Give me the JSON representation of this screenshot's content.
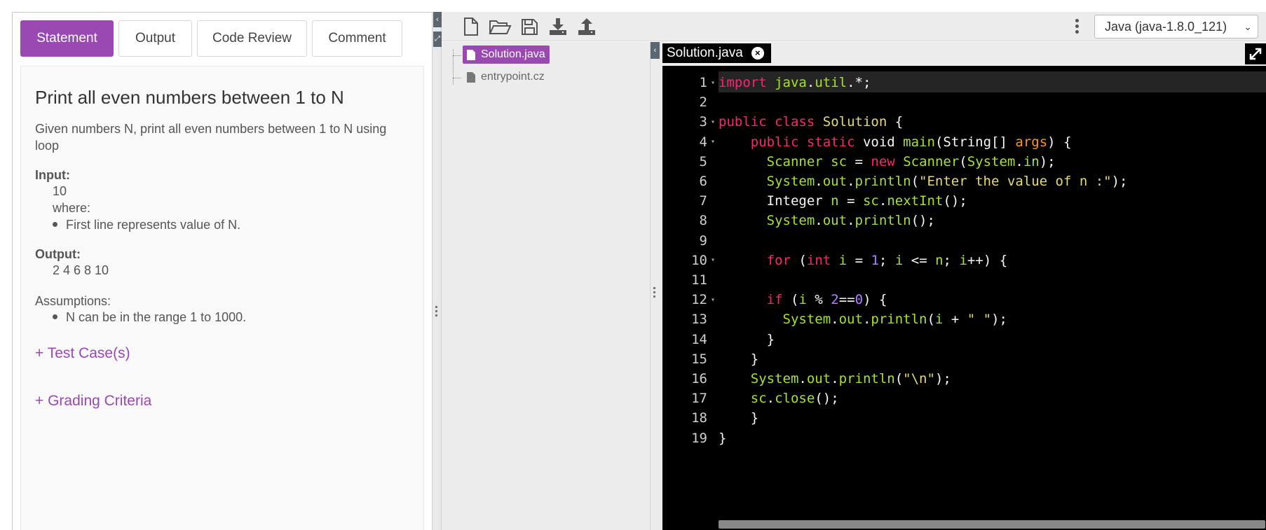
{
  "tabs": [
    {
      "label": "Statement"
    },
    {
      "label": "Output"
    },
    {
      "label": "Code Review"
    },
    {
      "label": "Comment"
    }
  ],
  "statement": {
    "title": "Print all even numbers between 1 to N",
    "description": "Given numbers N, print all even numbers between 1 to N using loop",
    "input_heading": "Input:",
    "input_value": "10",
    "input_where": "where:",
    "input_bullet": "First line represents value of N.",
    "output_heading": "Output:",
    "output_value": "2 4 6 8 10",
    "assumptions_heading": "Assumptions:",
    "assumptions_bullet": "N can be in the range 1 to 1000.",
    "test_cases_link": "+ Test Case(s)",
    "grading_link": "+ Grading Criteria"
  },
  "toolbar": {
    "icons": [
      "new-file-icon",
      "open-folder-icon",
      "save-icon",
      "download-icon",
      "upload-icon"
    ],
    "language": "Java (java-1.8.0_121)"
  },
  "file_tree": {
    "files": [
      {
        "name": "Solution.java",
        "active": true
      },
      {
        "name": "entrypoint.cz",
        "active": false
      }
    ]
  },
  "editor": {
    "tab_label": "Solution.java",
    "lines": [
      {
        "n": "1",
        "fold": true,
        "code": "import java.util.*;"
      },
      {
        "n": "2",
        "fold": false,
        "code": ""
      },
      {
        "n": "3",
        "fold": true,
        "code": "public class Solution {"
      },
      {
        "n": "4",
        "fold": true,
        "code": "    public static void main(String[] args) {"
      },
      {
        "n": "5",
        "fold": false,
        "code": "      Scanner sc = new Scanner(System.in);"
      },
      {
        "n": "6",
        "fold": false,
        "code": "      System.out.println(\"Enter the value of n :\");"
      },
      {
        "n": "7",
        "fold": false,
        "code": "      Integer n = sc.nextInt();"
      },
      {
        "n": "8",
        "fold": false,
        "code": "      System.out.println();"
      },
      {
        "n": "9",
        "fold": false,
        "code": ""
      },
      {
        "n": "10",
        "fold": true,
        "code": "      for (int i = 1; i <= n; i++) {"
      },
      {
        "n": "11",
        "fold": false,
        "code": ""
      },
      {
        "n": "12",
        "fold": true,
        "code": "      if (i % 2==0) {"
      },
      {
        "n": "13",
        "fold": false,
        "code": "        System.out.println(i + \" \");"
      },
      {
        "n": "14",
        "fold": false,
        "code": "      }"
      },
      {
        "n": "15",
        "fold": false,
        "code": "    }"
      },
      {
        "n": "16",
        "fold": false,
        "code": "    System.out.println(\"\\n\");"
      },
      {
        "n": "17",
        "fold": false,
        "code": "    sc.close();"
      },
      {
        "n": "18",
        "fold": false,
        "code": "    }"
      },
      {
        "n": "19",
        "fold": false,
        "code": "}"
      }
    ]
  }
}
